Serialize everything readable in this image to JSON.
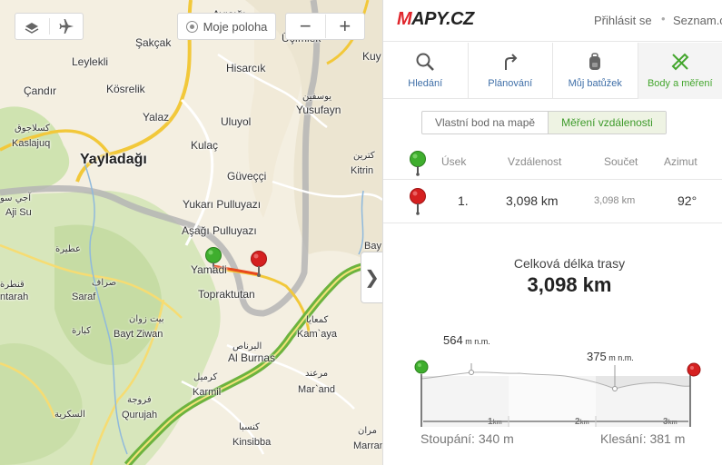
{
  "map": {
    "my_position_label": "Moje poloha",
    "zoom_out_label": "−",
    "zoom_in_label": "+",
    "collapse_label": "❯",
    "labels": {
      "aydin": "Ayışığı",
      "sakcak": "Şakçak",
      "leylekli": "Leylekli",
      "candir": "Çandır",
      "kosrelik": "Kösrelik",
      "hisarcik": "Hisarcık",
      "yalaz": "Yalaz",
      "uluyol": "Uluyol",
      "kulac": "Kulaç",
      "yayladagi": "Yayladağı",
      "guvecci": "Güveççi",
      "yukari": "Yukarı Pulluyazı",
      "asagi": "Aşağı Pulluyazı",
      "yamadi": "Yamadi",
      "topraktutan": "Topraktutan",
      "saraf": "Saraf",
      "bayt": "Bayt Ziwan",
      "alburnas": "Al Burnas",
      "kamaya": "Kam`aya",
      "karmil": "Karmil",
      "qurujah": "Qurujah",
      "marand": "Mar`and",
      "kinsibba": "Kinsibba",
      "marran": "Marran",
      "kitrin": "Kitrin",
      "yusufayn": "Yusufayn",
      "kaslajuq": "Kaslajuq",
      "ajisu": "Aji Su",
      "bay": "Bay",
      "ustimlek": "Üçımlek",
      "kuy": "Kuy",
      "tarah": "ntarah"
    },
    "arabic": {
      "kaslajuq_ar": "كسلاجوق",
      "ajisu_ar": "آجي سو",
      "kitrin_ar": "كترين",
      "yusufayn_ar": "يوسفين",
      "saraf_ar": "صراف",
      "bayt_ar": "بيت زوان",
      "alburnas_ar": "البرناص",
      "kamaya_ar": "كمعايا",
      "karmil_ar": "كرميل",
      "qurujah_ar": "فروجة",
      "marand_ar": "مرعند",
      "kinsibba_ar": "كنسبا",
      "marran_ar": "مران",
      "atira_ar": "عطيرة",
      "kbara_ar": "كبارة",
      "sakriya_ar": "السكرية",
      "tarah_ar": "قنطرة"
    }
  },
  "header": {
    "logo_m": "M",
    "logo_rest": "APY.CZ",
    "login": "Přihlásit se",
    "separator": "•",
    "seznam": "Seznam.cz"
  },
  "tabs": [
    {
      "label": "Hledání",
      "icon": "search-icon"
    },
    {
      "label": "Plánování",
      "icon": "route-arrow-icon"
    },
    {
      "label": "Můj batůžek",
      "icon": "backpack-icon"
    },
    {
      "label": "Body a měření",
      "icon": "ruler-pencil-icon"
    }
  ],
  "subtabs": {
    "custom_point": "Vlastní bod na mapě",
    "measure": "Měření vzdálenosti"
  },
  "table": {
    "headers": {
      "segment": "Úsek",
      "distance": "Vzdálenost",
      "sum": "Součet",
      "azimuth": "Azimut"
    },
    "rows": [
      {
        "segment": "1.",
        "distance": "3,098 km",
        "sum": "3,098 km",
        "azimuth": "92°"
      }
    ]
  },
  "summary": {
    "label": "Celková délka trasy",
    "value": "3,098 km"
  },
  "profile": {
    "max_elev": "564",
    "min_elev": "375",
    "unit": "m n.m.",
    "km_labels": [
      "1",
      "2",
      "3"
    ],
    "km_unit": "km",
    "ascent": "Stoupání: 340 m",
    "descent": "Klesání: 381 m"
  },
  "colors": {
    "brand_red": "#e0262c",
    "active_green": "#44a62e",
    "link_blue": "#3f6fa8",
    "route_line": "#e8491d"
  }
}
